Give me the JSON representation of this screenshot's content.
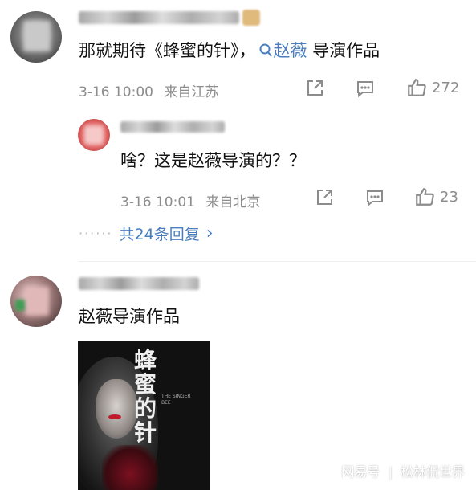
{
  "comments": [
    {
      "text_before": "那就期待《蜂蜜的针》，",
      "topic_icon": "search-icon",
      "topic": "赵薇",
      "text_after": " 导演作品",
      "time": "3-16 10:00",
      "location": "来自江苏",
      "likes": "272"
    },
    {
      "reply_text": "啥？这是赵薇导演的？？",
      "time": "3-16 10:01",
      "location": "来自北京",
      "likes": "23",
      "more_dots": "······",
      "more_text": "共24条回复",
      "more_chevron": "›"
    },
    {
      "text": "赵薇导演作品",
      "poster": {
        "title_chars": [
          "蜂",
          "蜜",
          "的",
          "针"
        ],
        "subtitle": "THE SINGER BEE"
      }
    }
  ],
  "watermark": {
    "brand": "网易号",
    "separator": "|",
    "author": "松林侃世界"
  },
  "colors": {
    "topic": "#4a7dbe",
    "meta": "#8c8c8c",
    "poster_bg": "#111111",
    "poster_title": "#f0f0f0",
    "poster_accent": "#c0192b"
  }
}
